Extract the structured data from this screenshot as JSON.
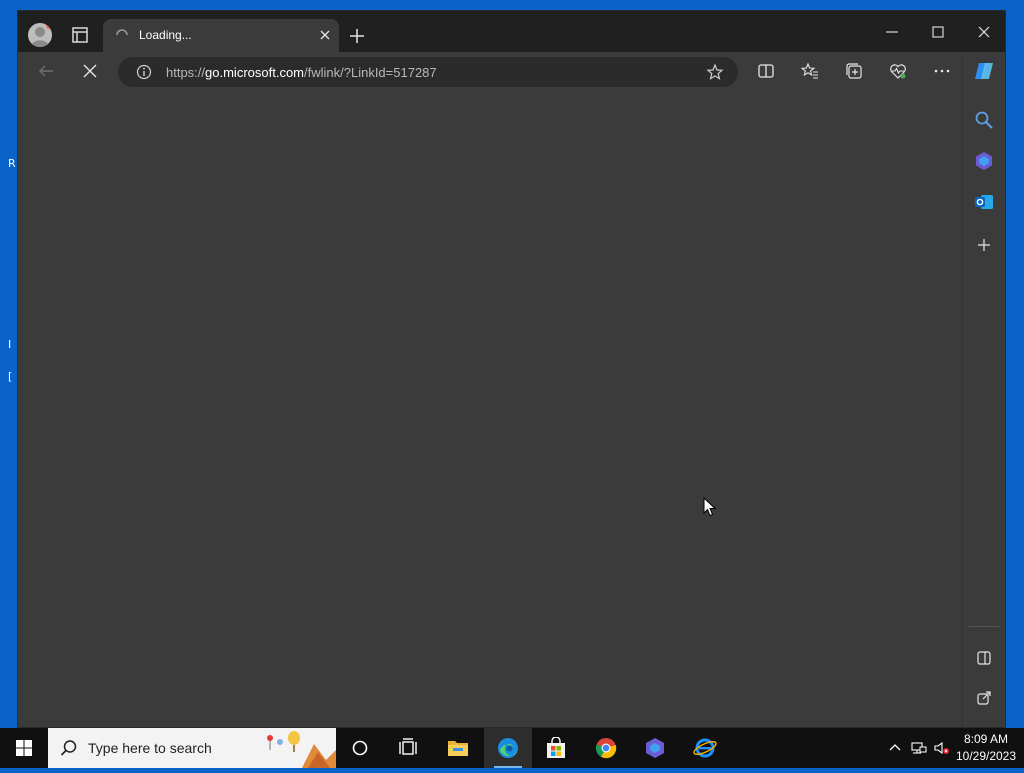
{
  "browser": {
    "tab": {
      "title": "Loading..."
    },
    "address": {
      "url_prefix": "https://",
      "url_host": "go.microsoft.com",
      "url_path": "/fwlink/?LinkId=517287"
    }
  },
  "desktop": {
    "glyph1": "R",
    "glyph2": "I",
    "glyph3": "["
  },
  "taskbar": {
    "search_placeholder": "Type here to search",
    "time": "8:09 AM",
    "date": "10/29/2023"
  },
  "colors": {
    "accent": "#76b9ed",
    "desktop": "#0a63c9",
    "titlebar": "#202020",
    "surface": "#3b3b3b"
  }
}
